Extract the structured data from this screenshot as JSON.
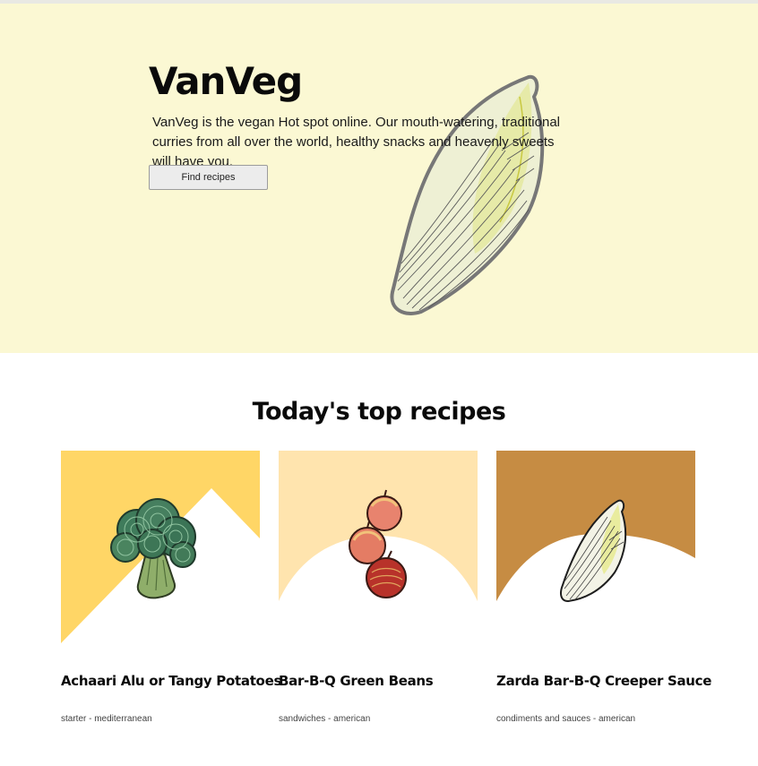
{
  "hero": {
    "title": "VanVeg",
    "description": "VanVeg is the vegan Hot spot online. Our mouth-watering, traditional curries from all over the world, healthy snacks and heavenly sweets will have you.",
    "button_label": "Find recipes",
    "background_color": "#fbf8d3",
    "illustration_icon": "endive-icon"
  },
  "top_recipes": {
    "heading": "Today's top recipes",
    "cards": [
      {
        "title": "Achaari Alu or Tangy Potatoes",
        "meta": "starter - mediterranean",
        "accent_color": "#ffd666",
        "illustration_icon": "broccoli-icon"
      },
      {
        "title": "Bar-B-Q Green Beans",
        "meta": "sandwiches - american",
        "accent_color": "#ffe4ae",
        "illustration_icon": "apples-icon"
      },
      {
        "title": "Zarda Bar-B-Q Creeper Sauce",
        "meta": "condiments and sauces - american",
        "accent_color": "#c68c43",
        "illustration_icon": "endive-icon"
      }
    ]
  }
}
